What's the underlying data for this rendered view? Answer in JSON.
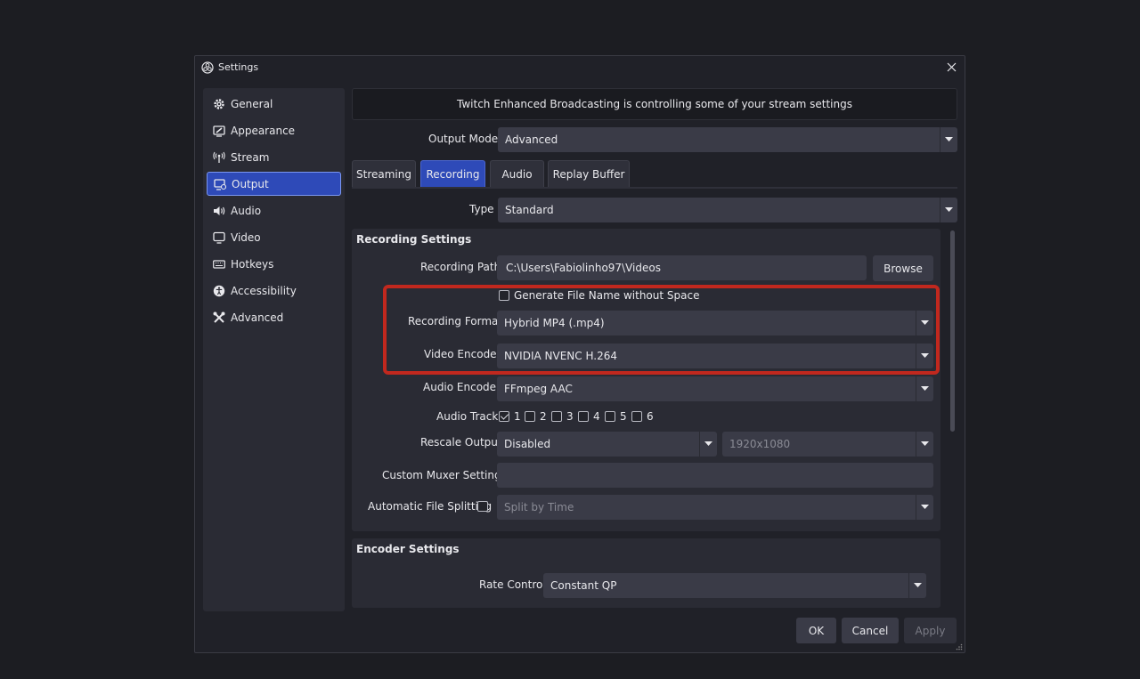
{
  "window": {
    "title": "Settings"
  },
  "sidebar": {
    "items": [
      {
        "label": "General",
        "icon": "gear-icon"
      },
      {
        "label": "Appearance",
        "icon": "appearance-icon"
      },
      {
        "label": "Stream",
        "icon": "antenna-icon"
      },
      {
        "label": "Output",
        "icon": "output-icon",
        "active": true
      },
      {
        "label": "Audio",
        "icon": "speaker-icon"
      },
      {
        "label": "Video",
        "icon": "monitor-icon"
      },
      {
        "label": "Hotkeys",
        "icon": "keyboard-icon"
      },
      {
        "label": "Accessibility",
        "icon": "accessibility-icon"
      },
      {
        "label": "Advanced",
        "icon": "tools-icon"
      }
    ]
  },
  "banner": "Twitch Enhanced Broadcasting is controlling some of your stream settings",
  "output_mode": {
    "label": "Output Mode",
    "value": "Advanced"
  },
  "tabs": [
    {
      "label": "Streaming"
    },
    {
      "label": "Recording",
      "active": true
    },
    {
      "label": "Audio"
    },
    {
      "label": "Replay Buffer"
    }
  ],
  "type": {
    "label": "Type",
    "value": "Standard"
  },
  "recording_settings": {
    "title": "Recording Settings",
    "path_label": "Recording Path",
    "path_value": "C:\\Users\\Fabiolinho97\\Videos",
    "browse_label": "Browse",
    "no_space_label": "Generate File Name without Space",
    "format_label": "Recording Format",
    "format_value": "Hybrid MP4 (.mp4)",
    "video_encoder_label": "Video Encoder",
    "video_encoder_value": "NVIDIA NVENC H.264",
    "audio_encoder_label": "Audio Encoder",
    "audio_encoder_value": "FFmpeg AAC",
    "audio_track_label": "Audio Track",
    "audio_tracks": [
      {
        "num": "1",
        "checked": true
      },
      {
        "num": "2",
        "checked": false
      },
      {
        "num": "3",
        "checked": false
      },
      {
        "num": "4",
        "checked": false
      },
      {
        "num": "5",
        "checked": false
      },
      {
        "num": "6",
        "checked": false
      }
    ],
    "rescale_label": "Rescale Output",
    "rescale_value": "Disabled",
    "rescale_resolution": "1920x1080",
    "muxer_label": "Custom Muxer Settings",
    "muxer_value": "",
    "splitting_label": "Automatic File Splitting",
    "splitting_value": "Split by Time"
  },
  "encoder_settings": {
    "title": "Encoder Settings",
    "rate_control_label": "Rate Control",
    "rate_control_value": "Constant QP"
  },
  "buttons": {
    "ok": "OK",
    "cancel": "Cancel",
    "apply": "Apply"
  },
  "colors": {
    "accent": "#2e4ab8",
    "highlight": "#c1281e",
    "background": "#1c1d22"
  }
}
